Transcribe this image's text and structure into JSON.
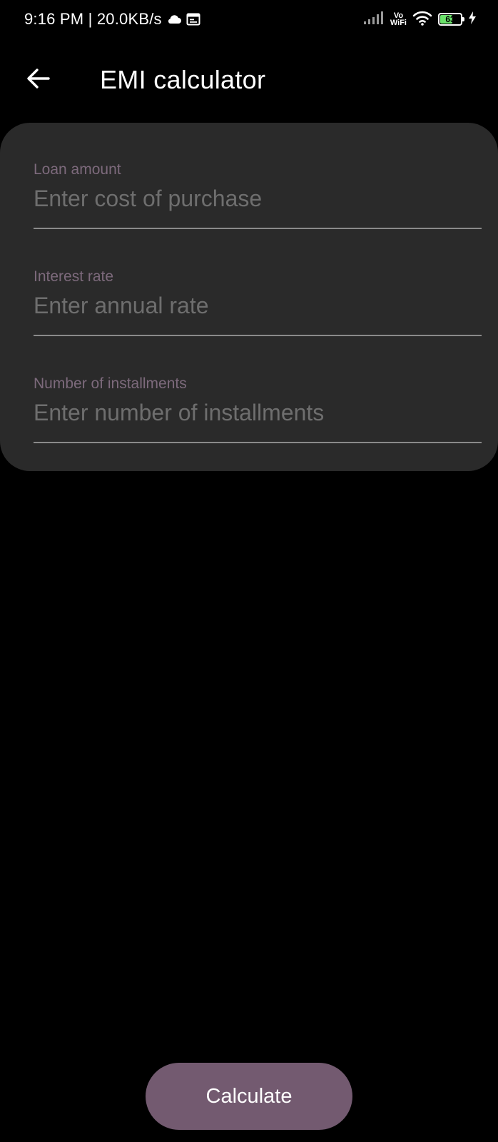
{
  "status_bar": {
    "time_speed": "9:16 PM | 20.0KB/s",
    "vowifi_top": "Vo",
    "vowifi_bottom": "WiFi",
    "battery_level": "63",
    "battery_fraction": 0.63,
    "battery_color": "#6be26b",
    "icons": [
      "cloud-icon",
      "notification-icon",
      "signal-icon",
      "wifi-icon",
      "battery-icon",
      "charging-icon"
    ]
  },
  "app_bar": {
    "back_icon": "arrow-left-icon",
    "title": "EMI calculator"
  },
  "form": {
    "loan_amount": {
      "label": "Loan amount",
      "placeholder": "Enter cost of purchase",
      "value": ""
    },
    "interest_rate": {
      "label": "Interest rate",
      "placeholder": "Enter annual rate",
      "value": ""
    },
    "installments": {
      "label": "Number of installments",
      "placeholder": "Enter number of installments",
      "value": ""
    }
  },
  "actions": {
    "calculate_label": "Calculate"
  },
  "colors": {
    "background": "#000000",
    "card": "#2a2a2a",
    "label": "#7d6a7c",
    "placeholder": "#6e6e6e",
    "button": "#735a70"
  }
}
